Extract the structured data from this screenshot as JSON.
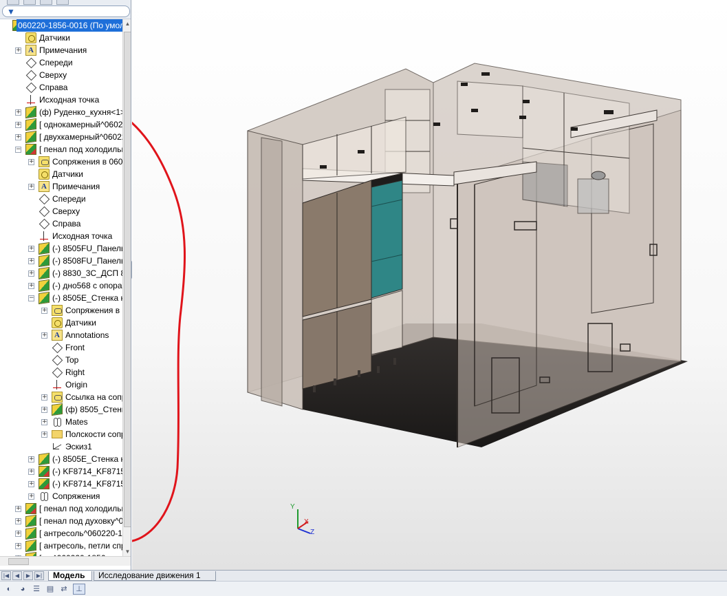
{
  "app": {
    "name": "SolidWorks"
  },
  "feature_manager": {
    "filter_placeholder": "",
    "tree": [
      {
        "label": "060220-1856-0016  (По умол",
        "indent": 0,
        "icon": "assembly-icon",
        "expander": "",
        "selected": true
      },
      {
        "label": "Датчики",
        "indent": 1,
        "icon": "sensor-icon",
        "expander": ""
      },
      {
        "label": "Примечания",
        "indent": 1,
        "icon": "annotations-icon",
        "expander": "+"
      },
      {
        "label": "Спереди",
        "indent": 1,
        "icon": "plane-icon",
        "expander": ""
      },
      {
        "label": "Сверху",
        "indent": 1,
        "icon": "plane-icon",
        "expander": ""
      },
      {
        "label": "Справа",
        "indent": 1,
        "icon": "plane-icon",
        "expander": ""
      },
      {
        "label": "Исходная точка",
        "indent": 1,
        "icon": "origin-icon",
        "expander": ""
      },
      {
        "label": "(ф) Руденко_кухня<1> (П",
        "indent": 1,
        "icon": "part-icon",
        "expander": "+"
      },
      {
        "label": "[ однокамерный^060220-",
        "indent": 1,
        "icon": "part-icon",
        "expander": "+"
      },
      {
        "label": "[ двухкамерный^060220-1",
        "indent": 1,
        "icon": "part-icon",
        "expander": "+"
      },
      {
        "label": "[ пенал под холодильни",
        "indent": 1,
        "icon": "subassembly-icon",
        "expander": "−"
      },
      {
        "label": "Сопряжения в 060220",
        "indent": 2,
        "icon": "mate-group-icon",
        "expander": "+"
      },
      {
        "label": "Датчики",
        "indent": 2,
        "icon": "sensor-icon",
        "expander": ""
      },
      {
        "label": "Примечания",
        "indent": 2,
        "icon": "annotations-icon",
        "expander": "+"
      },
      {
        "label": "Спереди",
        "indent": 2,
        "icon": "plane-icon",
        "expander": ""
      },
      {
        "label": "Сверху",
        "indent": 2,
        "icon": "plane-icon",
        "expander": ""
      },
      {
        "label": "Справа",
        "indent": 2,
        "icon": "plane-icon",
        "expander": ""
      },
      {
        "label": "Исходная точка",
        "indent": 2,
        "icon": "origin-icon",
        "expander": ""
      },
      {
        "label": "(-) 8505FU_Панель пр",
        "indent": 2,
        "icon": "part-icon",
        "expander": "+"
      },
      {
        "label": "(-) 8508FU_Панель вк",
        "indent": 2,
        "icon": "part-icon",
        "expander": "+"
      },
      {
        "label": "(-) 8830_3С_ДСП 8 мм",
        "indent": 2,
        "icon": "part-icon",
        "expander": "+"
      },
      {
        "label": "(-) дно568 с опорами",
        "indent": 2,
        "icon": "part-icon",
        "expander": "+"
      },
      {
        "label": "(-) 8505E_Стенка карк",
        "indent": 2,
        "icon": "part-icon",
        "expander": "−"
      },
      {
        "label": "Сопряжения в пе",
        "indent": 3,
        "icon": "mate-group-icon",
        "expander": "+"
      },
      {
        "label": "Датчики",
        "indent": 3,
        "icon": "sensor-icon",
        "expander": ""
      },
      {
        "label": "Annotations",
        "indent": 3,
        "icon": "annotations-icon",
        "expander": "+"
      },
      {
        "label": "Front",
        "indent": 3,
        "icon": "plane-icon",
        "expander": ""
      },
      {
        "label": "Top",
        "indent": 3,
        "icon": "plane-icon",
        "expander": ""
      },
      {
        "label": "Right",
        "indent": 3,
        "icon": "plane-icon",
        "expander": ""
      },
      {
        "label": "Origin",
        "indent": 3,
        "icon": "origin-icon",
        "expander": ""
      },
      {
        "label": "Ссылка на сопря:",
        "indent": 3,
        "icon": "mate-group-icon",
        "expander": "+"
      },
      {
        "label": "(ф) 8505_Стенка к",
        "indent": 3,
        "icon": "part-icon",
        "expander": "+"
      },
      {
        "label": "Mates",
        "indent": 3,
        "icon": "mates-icon",
        "expander": "+"
      },
      {
        "label": "Полскости сопря",
        "indent": 3,
        "icon": "folder-icon",
        "expander": "+"
      },
      {
        "label": "Эскиз1",
        "indent": 3,
        "icon": "sketch-icon",
        "expander": ""
      },
      {
        "label": "(-) 8505E_Стенка карк",
        "indent": 2,
        "icon": "part-icon",
        "expander": "+"
      },
      {
        "label": "(-) KF8714_KF8715_Фа",
        "indent": 2,
        "icon": "subassembly-icon",
        "expander": "+"
      },
      {
        "label": "(-) KF8714_KF8715_Фа",
        "indent": 2,
        "icon": "subassembly-icon",
        "expander": "+"
      },
      {
        "label": "Сопряжения",
        "indent": 2,
        "icon": "mates-icon",
        "expander": "+"
      },
      {
        "label": "[ пенал под холодильни",
        "indent": 1,
        "icon": "subassembly-icon",
        "expander": "+"
      },
      {
        "label": "[ пенал под духовку^060",
        "indent": 1,
        "icon": "part-icon",
        "expander": "+"
      },
      {
        "label": "[ антресоль^060220-1856",
        "indent": 1,
        "icon": "part-icon",
        "expander": "+"
      },
      {
        "label": "[ антресоль, петли справ",
        "indent": 1,
        "icon": "part-icon",
        "expander": "+"
      },
      {
        "label": "[ ... ^060220-1856",
        "indent": 1,
        "icon": "part-icon",
        "expander": "+"
      }
    ]
  },
  "triad": {
    "x": "X",
    "y": "Y",
    "z": "Z"
  },
  "bottom_tabs": [
    {
      "label": "Модель",
      "active": true
    },
    {
      "label": "Исследование движения 1",
      "active": false
    }
  ],
  "toolbar_icons": [
    "hide-show-icon",
    "appearance-icon",
    "list-icon",
    "toggle-icon",
    "chart-icon",
    "triad-icon"
  ],
  "colors": {
    "selection": "#1e6fd9",
    "annotation_circle": "#e0141b",
    "cabinet_accent": "#2d8a8a"
  }
}
